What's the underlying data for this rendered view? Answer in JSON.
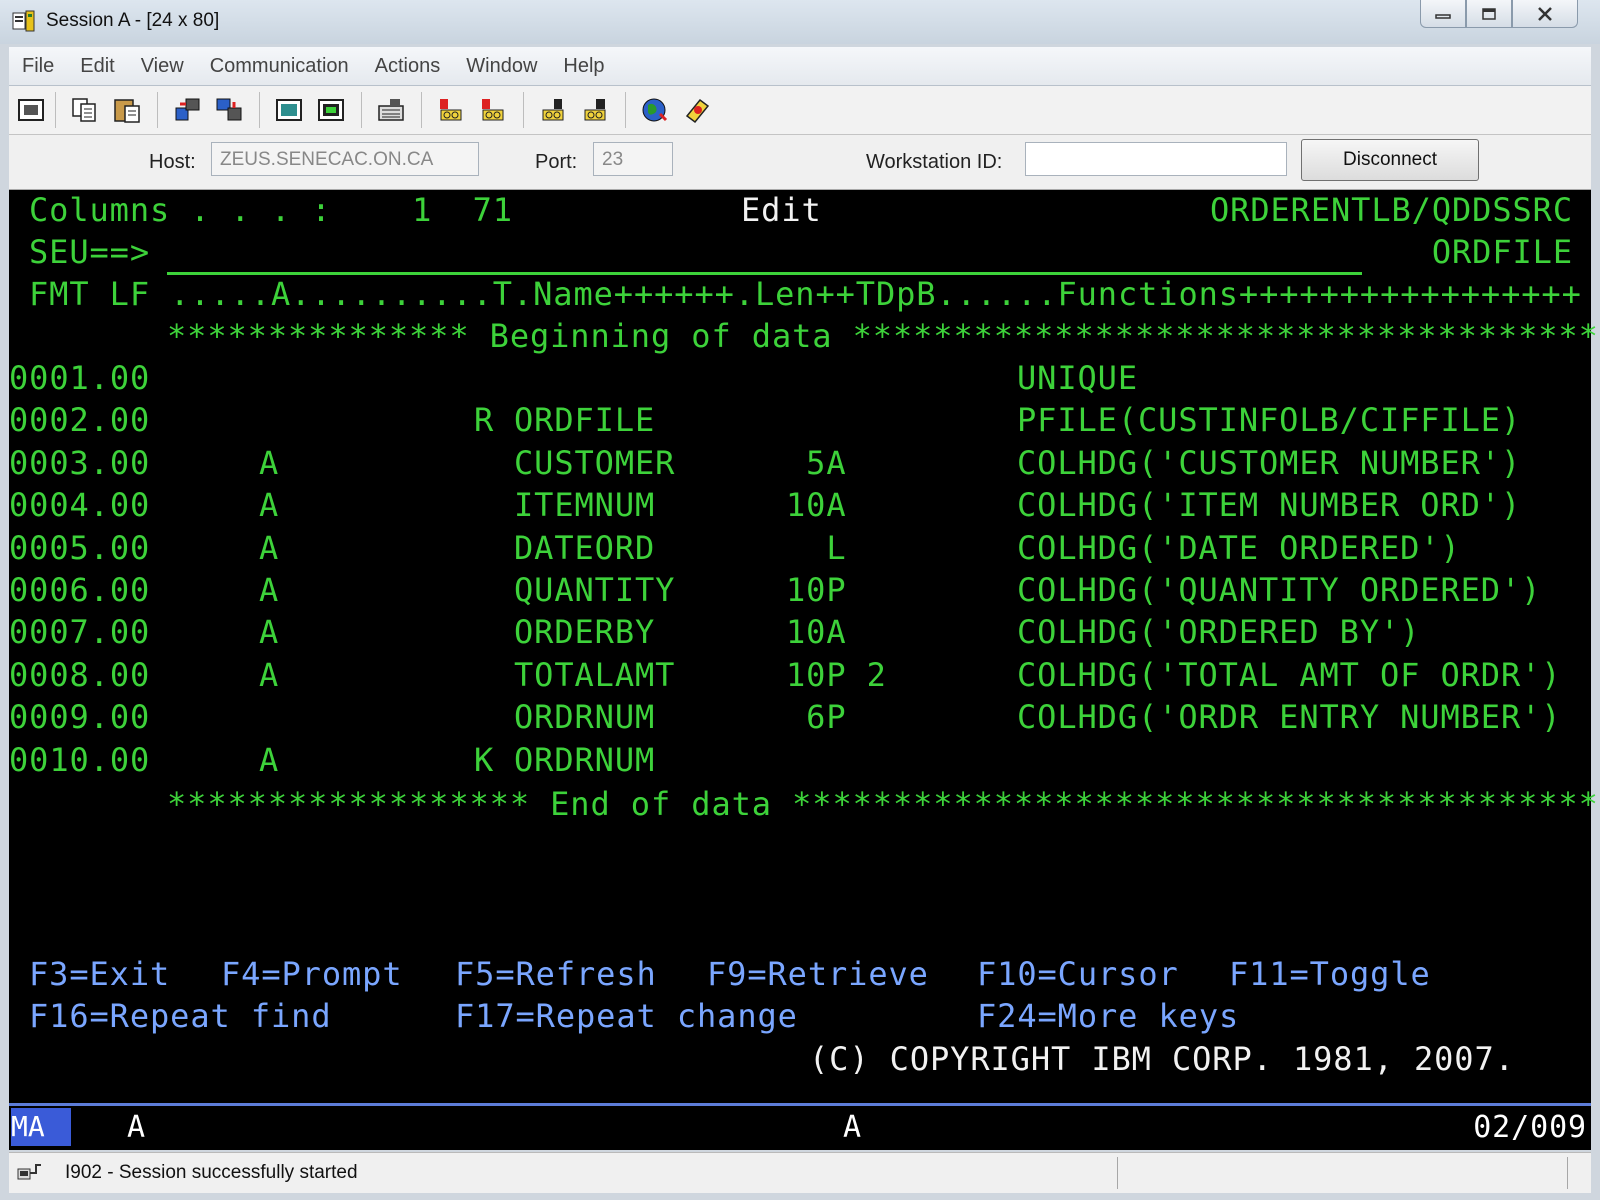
{
  "window": {
    "title": "Session A - [24 x 80]"
  },
  "menu": [
    "File",
    "Edit",
    "View",
    "Communication",
    "Actions",
    "Window",
    "Help"
  ],
  "toolbar": {
    "icons": [
      "display-icon",
      "copy-icon",
      "paste-icon",
      "send-file-icon",
      "receive-file-icon",
      "print-screen-icon",
      "display-options-icon",
      "keyboard-icon",
      "macro-record-icon",
      "macro-play-icon",
      "macro-stop-icon",
      "macro-play2-icon",
      "globe-icon",
      "help-icon"
    ]
  },
  "host": {
    "host_label": "Host:",
    "host_value": "ZEUS.SENECAC.ON.CA",
    "port_label": "Port:",
    "port_value": "23",
    "ws_label": "Workstation ID:",
    "ws_value": "",
    "disconnect_label": "Disconnect"
  },
  "screen": {
    "header": {
      "columns": "Columns . . . :    1  71",
      "mode": "Edit",
      "library": "ORDERENTLB/QDDSSRC",
      "seu_prompt": "SEU==>",
      "member": "ORDFILE",
      "format_line": "FMT LF .....A..........T.Name++++++.Len++TDpB......Functions+++++++++++++++++",
      "beginning": "*************** Beginning of data *************************************",
      "end": "****************** End of data ****************************************"
    },
    "rows": [
      {
        "seq": "0001.00",
        "a": "",
        "t": "",
        "name": "",
        "len": "",
        "functions": "UNIQUE"
      },
      {
        "seq": "0002.00",
        "a": "",
        "t": "R",
        "name": "ORDFILE",
        "len": "",
        "functions": "PFILE(CUSTINFOLB/CIFFILE)"
      },
      {
        "seq": "0003.00",
        "a": "A",
        "t": "",
        "name": "CUSTOMER",
        "len": " 5A",
        "functions": "COLHDG('CUSTOMER NUMBER')"
      },
      {
        "seq": "0004.00",
        "a": "A",
        "t": "",
        "name": "ITEMNUM",
        "len": "10A",
        "functions": "COLHDG('ITEM NUMBER ORD')"
      },
      {
        "seq": "0005.00",
        "a": "A",
        "t": "",
        "name": "DATEORD",
        "len": "  L",
        "functions": "COLHDG('DATE ORDERED')"
      },
      {
        "seq": "0006.00",
        "a": "A",
        "t": "",
        "name": "QUANTITY",
        "len": "10P",
        "functions": "COLHDG('QUANTITY ORDERED')"
      },
      {
        "seq": "0007.00",
        "a": "A",
        "t": "",
        "name": "ORDERBY",
        "len": "10A",
        "functions": "COLHDG('ORDERED BY')"
      },
      {
        "seq": "0008.00",
        "a": "A",
        "t": "",
        "name": "TOTALAMT",
        "len": "10P 2",
        "functions": "COLHDG('TOTAL AMT OF ORDR')"
      },
      {
        "seq": "0009.00",
        "a": "",
        "t": "",
        "name": "ORDRNUM",
        "len": " 6P",
        "functions": "COLHDG('ORDR ENTRY NUMBER')"
      },
      {
        "seq": "0010.00",
        "a": "A",
        "t": "K",
        "name": "ORDRNUM",
        "len": "",
        "functions": ""
      }
    ],
    "fkeys": {
      "row1": [
        {
          "label": "F3=Exit"
        },
        {
          "label": "F4=Prompt"
        },
        {
          "label": "F5=Refresh"
        },
        {
          "label": "F9=Retrieve"
        },
        {
          "label": "F10=Cursor"
        },
        {
          "label": "F11=Toggle"
        }
      ],
      "row2": [
        {
          "label": "F16=Repeat find"
        },
        {
          "label": "F17=Repeat change"
        },
        {
          "label": "F24=More keys"
        }
      ]
    },
    "copyright": "(C) COPYRIGHT IBM CORP. 1981, 2007."
  },
  "oia": {
    "ma": "MA",
    "a1": "A",
    "a2": "A",
    "cursor": "02/009"
  },
  "status": {
    "message": "I902 - Session successfully started"
  },
  "colors": {
    "terminal_bg": "#000000",
    "terminal_green": "#3dd23a",
    "terminal_white": "#f2f2f2",
    "terminal_blue": "#7aa6ff",
    "oia_accent": "#3a5bd8"
  }
}
